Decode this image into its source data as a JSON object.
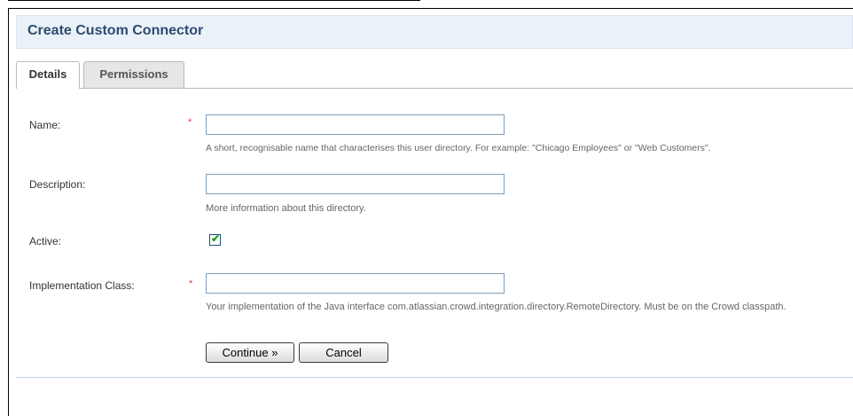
{
  "page": {
    "title": "Create Custom Connector"
  },
  "tabs": [
    {
      "label": "Details",
      "active": true
    },
    {
      "label": "Permissions",
      "active": false
    }
  ],
  "form": {
    "name": {
      "label": "Name:",
      "required_mark": "*",
      "value": "",
      "help": "A short, recognisable name that characterises this user directory. For example: \"Chicago Employees\" or \"Web Customers\"."
    },
    "description": {
      "label": "Description:",
      "value": "",
      "help": "More information about this directory."
    },
    "active": {
      "label": "Active:",
      "checked": true,
      "check_glyph": "✔"
    },
    "implementation_class": {
      "label": "Implementation Class:",
      "required_mark": "*",
      "value": "",
      "help": "Your implementation of the Java interface com.atlassian.crowd.integration.directory.RemoteDirectory. Must be on the Crowd classpath."
    }
  },
  "buttons": {
    "continue_label": "Continue »",
    "cancel_label": "Cancel"
  },
  "colors": {
    "header_background": "#eaf1f9",
    "title_text": "#2e4c6e",
    "required": "#d04437",
    "checkmark": "#21a121"
  }
}
